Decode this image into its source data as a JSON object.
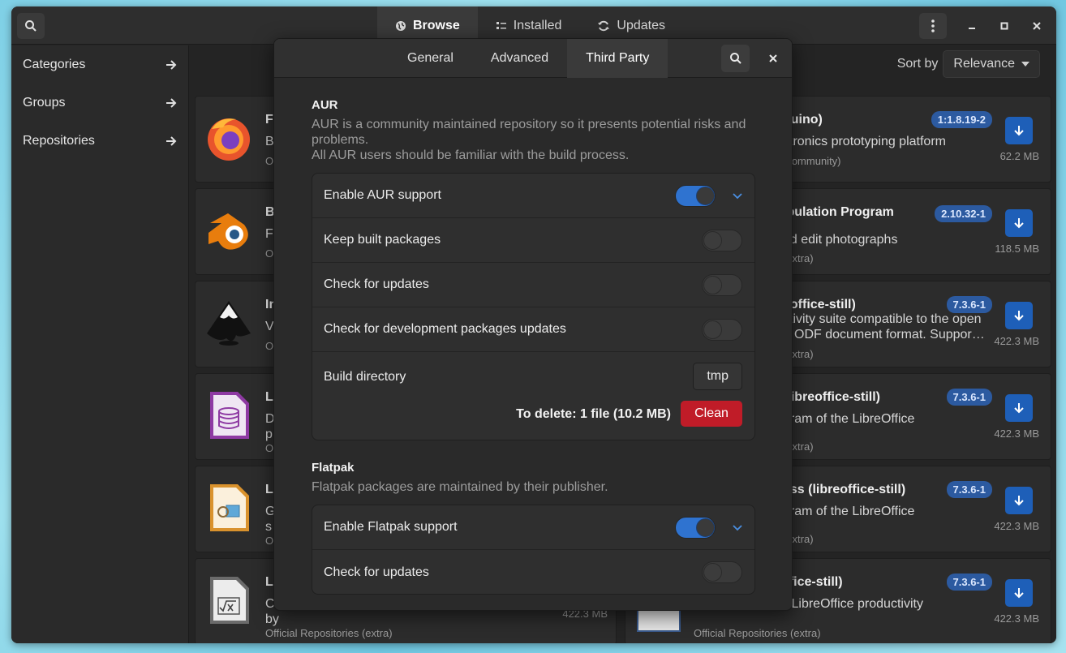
{
  "header": {
    "tabs": [
      {
        "label": "Browse",
        "icon": "globe-icon"
      },
      {
        "label": "Installed",
        "icon": "list-icon"
      },
      {
        "label": "Updates",
        "icon": "refresh-icon"
      }
    ]
  },
  "sidebar": {
    "items": [
      {
        "label": "Categories"
      },
      {
        "label": "Groups"
      },
      {
        "label": "Repositories"
      }
    ]
  },
  "sort": {
    "label": "Sort by",
    "value": "Relevance"
  },
  "cards_left": [
    {
      "title": "F",
      "desc": "B",
      "desc2": "",
      "repo": "O"
    },
    {
      "title": "B",
      "desc": "F",
      "desc2": "",
      "repo": "O"
    },
    {
      "title": "In",
      "desc": "V",
      "desc2": "",
      "repo": "O"
    },
    {
      "title": "L",
      "desc": "D",
      "desc2": "p",
      "repo": "O"
    },
    {
      "title": "L",
      "desc": "G",
      "desc2": "s",
      "repo": "O"
    },
    {
      "title": "L",
      "desc": "C",
      "desc2": "by",
      "repo": "Official Repositories (extra)",
      "size": "422.3 MB"
    }
  ],
  "cards_right": [
    {
      "title": "duino)",
      "desc": "ctronics prototyping platform",
      "desc2": "",
      "repo": "(community)",
      "version": "1:1.8.19-2",
      "size": "62.2 MB"
    },
    {
      "title": "ipulation Program",
      "desc": "",
      "desc2": "nd edit photographs",
      "repo": "(extra)",
      "version": "2.10.32-1",
      "size": "118.5 MB"
    },
    {
      "title": "eoffice-still)",
      "desc": "ctivity suite compatible to the open",
      "desc2": "ODF document format. Suppor…",
      "repo": "(extra)",
      "version": "7.3.6-1",
      "size": "422.3 MB"
    },
    {
      "title": "(libreoffice-still)",
      "desc": "gram of the LibreOffice",
      "desc2": "",
      "repo": "(extra)",
      "version": "7.3.6-1",
      "size": "422.3 MB"
    },
    {
      "title": "ess (libreoffice-still)",
      "desc": "gram of the LibreOffice",
      "desc2": "",
      "repo": "(extra)",
      "version": "7.3.6-1",
      "size": "422.3 MB"
    },
    {
      "title": "er (libreoffice-still)",
      "desc": "part of the LibreOffice productivity",
      "desc2": "",
      "repo": "Official Repositories (extra)",
      "version": "7.3.6-1",
      "size": "422.3 MB"
    }
  ],
  "dialog": {
    "tabs": [
      "General",
      "Advanced",
      "Third Party"
    ],
    "active_tab": "Third Party",
    "aur": {
      "title": "AUR",
      "desc1": "AUR is a community maintained repository so it presents potential risks and problems.",
      "desc2": "All AUR users should be familiar with the build process.",
      "rows": [
        {
          "label": "Enable AUR support",
          "on": true
        },
        {
          "label": "Keep built packages",
          "on": false
        },
        {
          "label": "Check for updates",
          "on": false
        },
        {
          "label": "Check for development packages updates",
          "on": false
        }
      ],
      "build_dir_label": "Build directory",
      "build_dir_value": "tmp",
      "to_delete": "To delete:  1 file  (10.2 MB)",
      "clean_label": "Clean"
    },
    "flatpak": {
      "title": "Flatpak",
      "desc": "Flatpak packages are maintained by their publisher.",
      "rows": [
        {
          "label": "Enable Flatpak support",
          "on": true
        },
        {
          "label": "Check for updates",
          "on": false
        }
      ]
    }
  },
  "colors": {
    "accent": "#2f73d0",
    "destructive": "#c01c28",
    "badge": "#2c5aa0"
  }
}
